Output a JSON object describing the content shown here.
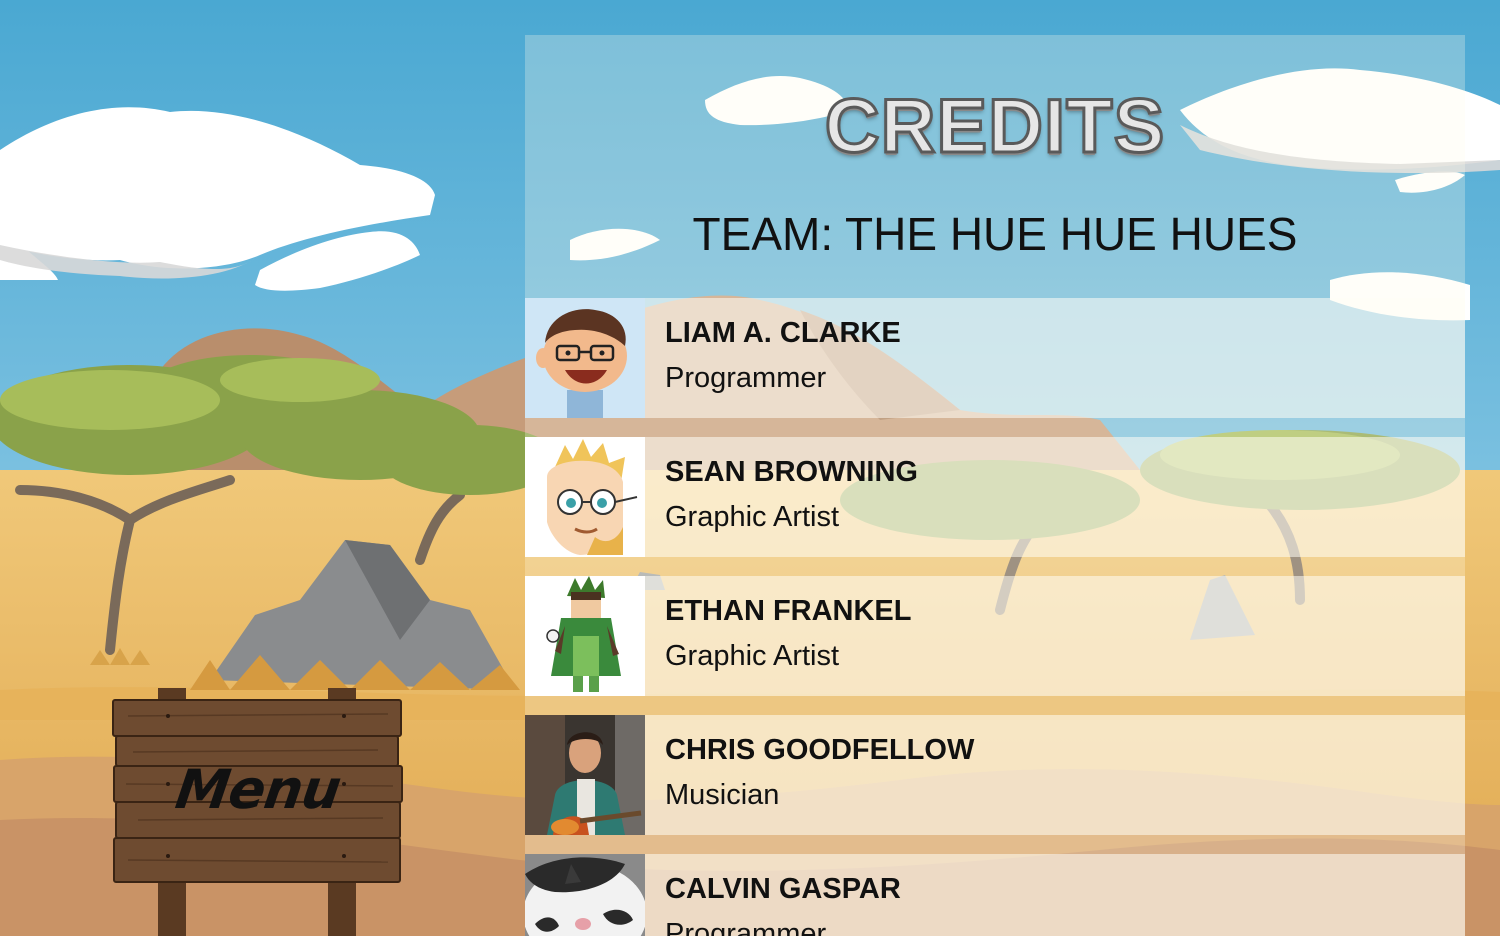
{
  "screen": "credits",
  "credits": {
    "title": "CREDITS",
    "team": "TEAM: THE HUE HUE HUES",
    "members": [
      {
        "name": "LIAM A. CLARKE",
        "role": "Programmer",
        "avatar": "cartoon-glasses-boy-avatar"
      },
      {
        "name": "SEAN BROWNING",
        "role": "Graphic Artist",
        "avatar": "blond-cartoon-glasses-avatar"
      },
      {
        "name": "ETHAN FRANKEL",
        "role": "Graphic Artist",
        "avatar": "pixel-character-green-cloak-avatar"
      },
      {
        "name": "CHRIS GOODFELLOW",
        "role": "Musician",
        "avatar": "guitar-player-photo-avatar"
      },
      {
        "name": "CALVIN GASPAR",
        "role": "Programmer",
        "avatar": "cat-photo-avatar"
      }
    ]
  },
  "menu_sign": {
    "label": "Menu"
  },
  "colors": {
    "sky": "#4aa8d2",
    "savanna": "#e9b85f",
    "panel_overlay": "#fffaeb",
    "sign_wood": "#6b4a30"
  }
}
